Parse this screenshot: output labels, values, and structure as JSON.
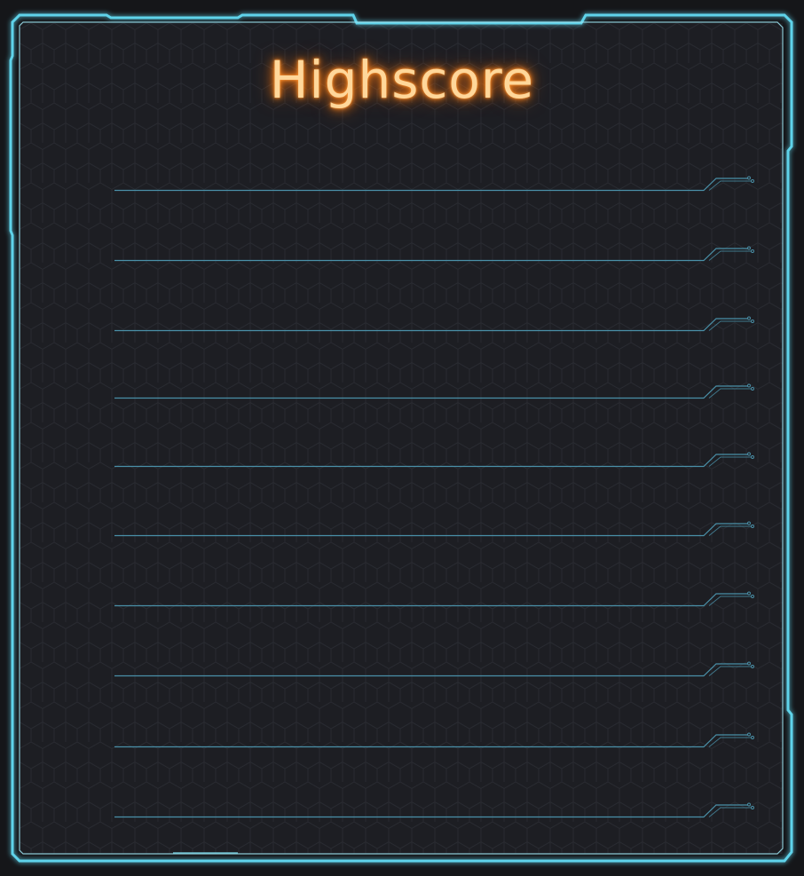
{
  "title": "Highscore",
  "colors": {
    "frame": "#5fd3ea",
    "title_glow": "#ff8a22",
    "title_fill": "#ffd79a",
    "row_line": "#4a90a8",
    "panel_bg": "#1d1e23"
  },
  "entries": [
    {
      "name": "",
      "score": ""
    },
    {
      "name": "",
      "score": ""
    },
    {
      "name": "",
      "score": ""
    },
    {
      "name": "",
      "score": ""
    },
    {
      "name": "",
      "score": ""
    },
    {
      "name": "",
      "score": ""
    },
    {
      "name": "",
      "score": ""
    },
    {
      "name": "",
      "score": ""
    },
    {
      "name": "",
      "score": ""
    },
    {
      "name": "",
      "score": ""
    }
  ]
}
